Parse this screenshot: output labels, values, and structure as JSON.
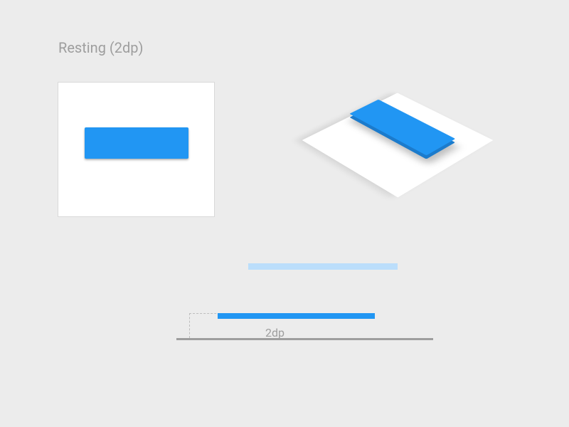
{
  "title": "Resting (2dp)",
  "side_label": "2dp",
  "colors": {
    "accent": "#2196F3",
    "accent_pale": "#BBDEFB",
    "ground": "#9E9E9E",
    "panel": "#FFFFFF",
    "page_bg": "#ECECEC"
  },
  "elevation_dp": 2,
  "diagram": {
    "flat_view": "button on white card, 2dp shadow",
    "iso_view": "same button shown in isometric 3D above card surface",
    "side_view": "cross-section: blue bar raised 2dp above grey ground line; pale blue bar = reference surface"
  }
}
